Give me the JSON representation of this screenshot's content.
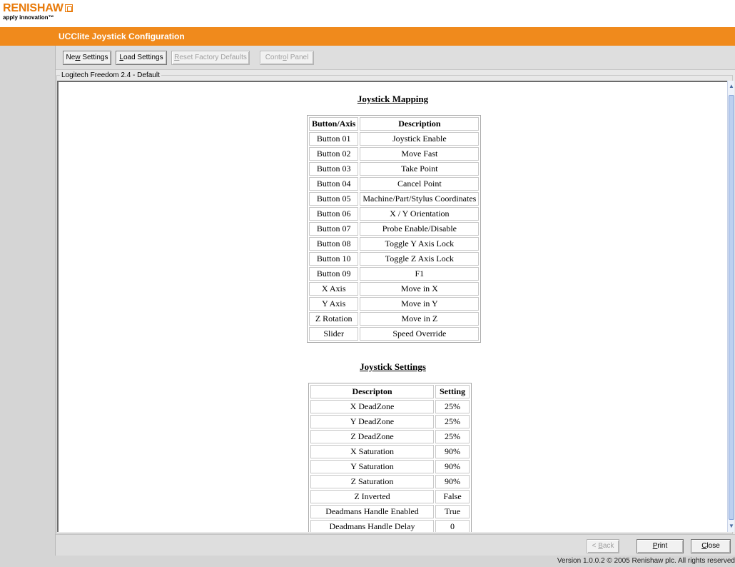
{
  "logo": {
    "wordmark": "RENISHAW",
    "tagline": "apply innovation™"
  },
  "app": {
    "title": "UCClite Joystick Configuration"
  },
  "toolbar": {
    "new_settings": "New Settings",
    "load_settings": "Load Settings",
    "reset_factory": "Reset Factory Defaults",
    "control_panel": "Control Panel"
  },
  "group": {
    "label": "Logitech Freedom 2.4 - Default"
  },
  "mapping": {
    "title": "Joystick Mapping",
    "headers": [
      "Button/Axis",
      "Description"
    ],
    "rows": [
      [
        "Button 01",
        "Joystick Enable"
      ],
      [
        "Button 02",
        "Move Fast"
      ],
      [
        "Button 03",
        "Take Point"
      ],
      [
        "Button 04",
        "Cancel Point"
      ],
      [
        "Button 05",
        "Machine/Part/Stylus Coordinates"
      ],
      [
        "Button 06",
        "X / Y Orientation"
      ],
      [
        "Button 07",
        "Probe Enable/Disable"
      ],
      [
        "Button 08",
        "Toggle Y Axis Lock"
      ],
      [
        "Button 10",
        "Toggle Z Axis Lock"
      ],
      [
        "Button 09",
        "F1"
      ],
      [
        "X Axis",
        "Move in X"
      ],
      [
        "Y Axis",
        "Move in Y"
      ],
      [
        "Z Rotation",
        "Move in Z"
      ],
      [
        "Slider",
        "Speed Override"
      ]
    ]
  },
  "settings": {
    "title": "Joystick Settings",
    "headers": [
      "Descripton",
      "Setting"
    ],
    "rows": [
      [
        "X DeadZone",
        "25%"
      ],
      [
        "Y DeadZone",
        "25%"
      ],
      [
        "Z DeadZone",
        "25%"
      ],
      [
        "X Saturation",
        "90%"
      ],
      [
        "Y Saturation",
        "90%"
      ],
      [
        "Z Saturation",
        "90%"
      ],
      [
        "Z Inverted",
        "False"
      ],
      [
        "Deadmans Handle Enabled",
        "True"
      ],
      [
        "Deadmans Handle Delay",
        "0"
      ]
    ]
  },
  "nav": {
    "back": "< Back",
    "print": "Print",
    "close": "Close"
  },
  "footer": {
    "version": "Version 1.0.0.2 © 2005 Renishaw plc. All rights reserved"
  },
  "colors": {
    "accent": "#f08a1c",
    "panel": "#dedede"
  },
  "icons": {
    "scroll_up": "chevron-up-icon",
    "scroll_down": "chevron-down-icon"
  }
}
